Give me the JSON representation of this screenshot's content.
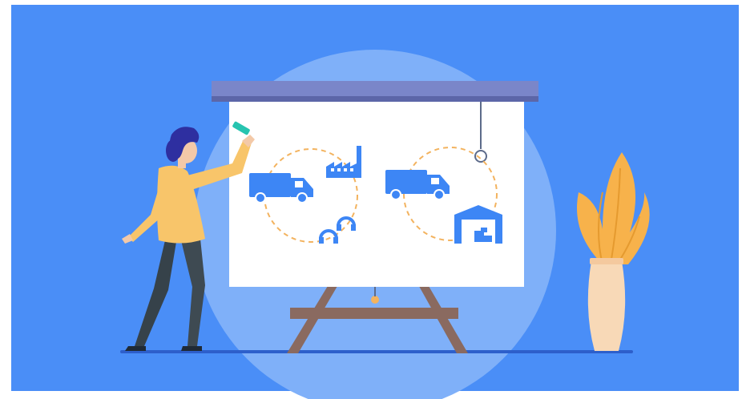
{
  "illustration": {
    "icons": [
      "truck-icon",
      "factory-icon",
      "headset-icon",
      "truck-icon",
      "warehouse-icon"
    ],
    "colors": {
      "background": "#4a8ef7",
      "halo": "#7fb0f9",
      "board": "#ffffff",
      "board_bar": "#7a86c9",
      "easel": "#8a6a60",
      "icon_blue": "#3d86f5",
      "dashed_ring": "#f3b35f",
      "shirt": "#f8c56a",
      "pants": "#3e4a52",
      "hair": "#2e2fa0",
      "marker": "#27c4b0",
      "plant_leaf": "#f7b24b",
      "vase": "#f8d9b7"
    }
  }
}
